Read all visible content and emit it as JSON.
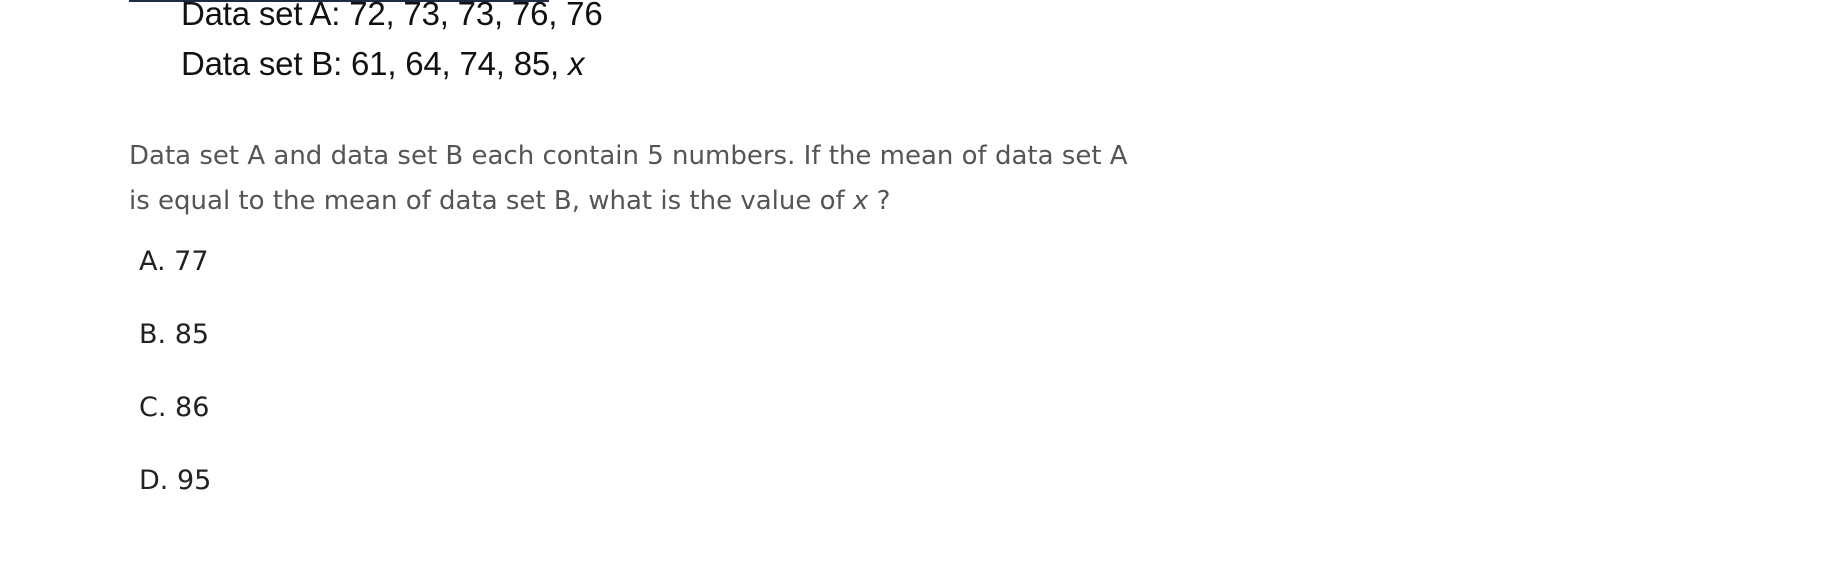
{
  "dataset_image": {
    "line_a": "Data set A: 72, 73, 73, 76, 76",
    "line_b_prefix": "Data set B: 61, 64, 74, 85, ",
    "line_b_var": "x"
  },
  "question": {
    "line1": "Data set A and data set B each contain 5 numbers. If the mean of data set A",
    "line2_prefix": "is equal to the mean of data set B, what is the value of ",
    "line2_var": "x",
    "line2_suffix": " ?"
  },
  "choices": [
    {
      "label": "A. 77"
    },
    {
      "label": "B. 85"
    },
    {
      "label": "C. 86"
    },
    {
      "label": "D. 95"
    }
  ]
}
